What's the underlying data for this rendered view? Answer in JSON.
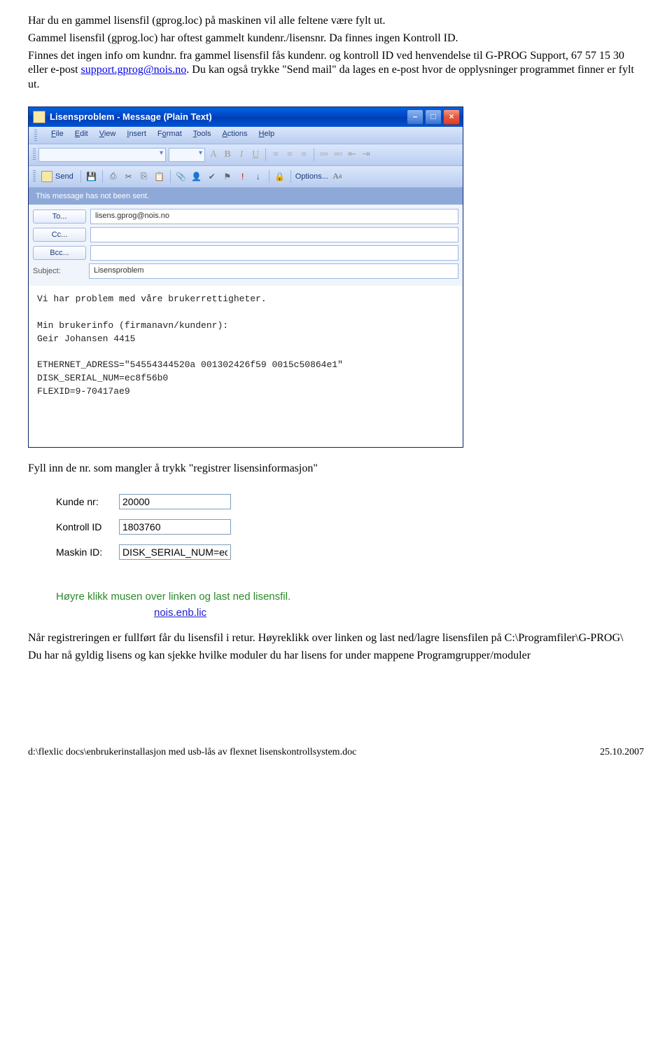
{
  "intro": {
    "p1": "Har du en gammel lisensfil (gprog.loc) på maskinen vil alle feltene være fylt ut.",
    "p2": "Gammel lisensfil (gprog.loc) har oftest gammelt kundenr./lisensnr. Da finnes ingen Kontroll ID.",
    "p3a": "Finnes det ingen info om kundnr. fra gammel lisensfil fås kundenr. og kontroll ID ved henvendelse til G-PROG Support, 67 57 15 30 eller e-post ",
    "p3link": "support.gprog@nois.no",
    "p3b": ". Du kan også trykke \"Send mail\" da lages en e-post hvor de opplysninger programmet finner er fylt ut."
  },
  "outlook": {
    "title": "Lisensproblem - Message (Plain Text)",
    "menu": [
      "File",
      "Edit",
      "View",
      "Insert",
      "Format",
      "Tools",
      "Actions",
      "Help"
    ],
    "send": "Send",
    "options": "Options...",
    "notsent": "This message has not been sent.",
    "to_btn": "To...",
    "to_val": "lisens.gprog@nois.no",
    "cc_btn": "Cc...",
    "cc_val": "",
    "bcc_btn": "Bcc...",
    "bcc_val": "",
    "subj_lbl": "Subject:",
    "subj_val": "Lisensproblem",
    "body": "Vi har problem med våre brukerrettigheter.\n\nMin brukerinfo (firmanavn/kundenr):\nGeir Johansen 4415\n\nETHERNET_ADRESS=\"54554344520a 001302426f59 0015c50864e1\"\nDISK_SERIAL_NUM=ec8f56b0\nFLEXID=9-70417ae9"
  },
  "mid": {
    "p1": "Fyll inn de nr. som mangler å trykk \"registrer lisensinformasjon\""
  },
  "reg": {
    "kunde_lbl": "Kunde nr:",
    "kunde_val": "20000",
    "kontroll_lbl": "Kontroll ID",
    "kontroll_val": "1803760",
    "maskin_lbl": "Maskin ID:",
    "maskin_val": "DISK_SERIAL_NUM=ec",
    "hint": "Høyre klikk musen over linken og last ned lisensfil.",
    "link": "nois.enb.lic"
  },
  "after": {
    "p1": "Når registreringen er fullført får du lisensfil i retur. Høyreklikk over linken og last ned/lagre lisensfilen på C:\\Programfiler\\G-PROG\\",
    "p2": "Du har nå gyldig lisens og kan sjekke hvilke moduler du har lisens for under mappene Programgrupper/moduler"
  },
  "footer": {
    "path": "d:\\flexlic docs\\enbrukerinstallasjon med usb-lås av flexnet lisenskontrollsystem.doc",
    "date": "25.10.2007"
  }
}
